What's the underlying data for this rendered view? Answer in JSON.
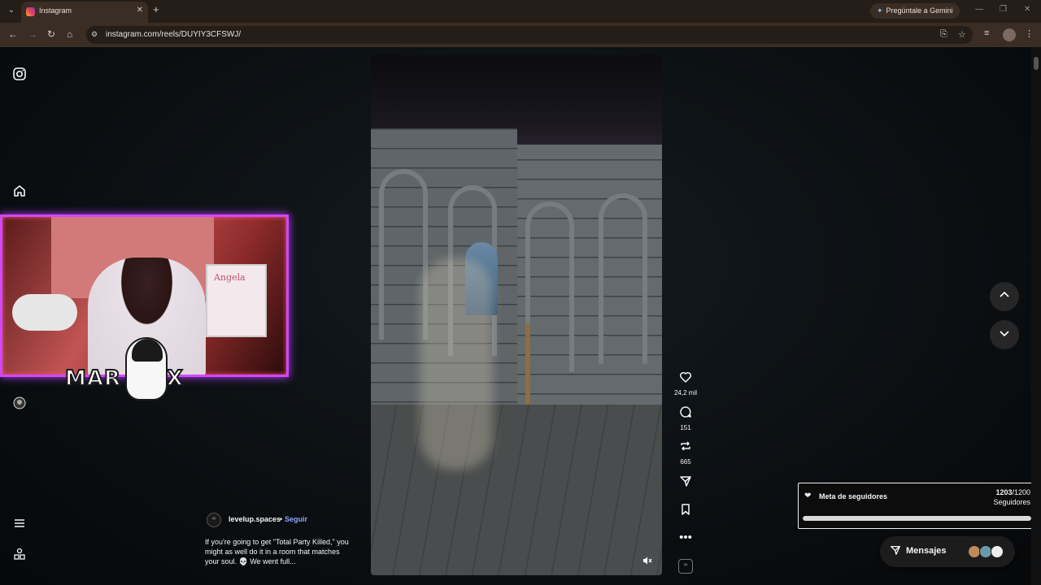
{
  "browser": {
    "tab_title": "Instagram",
    "gemini_label": "Pregúntale a Gemini",
    "url": "instagram.com/reels/DUYIY3CFSWJ/"
  },
  "reel": {
    "author": "levelup.spaces",
    "separator": "•",
    "follow_label": "Seguir",
    "caption": "If you're going to get \"Total Party Killed,\" you might as well do it in a room that matches your soul. 💀 We went full...",
    "likes": "24,2 mil",
    "comments": "151",
    "reposts": "665"
  },
  "overlay": {
    "stream_name": "MAR EMX",
    "board_text": "Angela"
  },
  "follower_goal": {
    "title": "Meta de seguidores",
    "current": "1203",
    "target": "/1200",
    "unit": "Seguidores",
    "progress_fraction": 1.0
  },
  "messages": {
    "label": "Mensajes"
  },
  "icons": {
    "instagram": "instagram-icon",
    "home": "home-icon",
    "heart": "heart-icon",
    "comment": "comment-icon",
    "repost": "repost-icon",
    "share": "share-icon",
    "save": "bookmark-icon",
    "more": "more-icon",
    "mute": "mute-icon",
    "menu": "menu-icon",
    "more_apps": "apps-icon"
  }
}
